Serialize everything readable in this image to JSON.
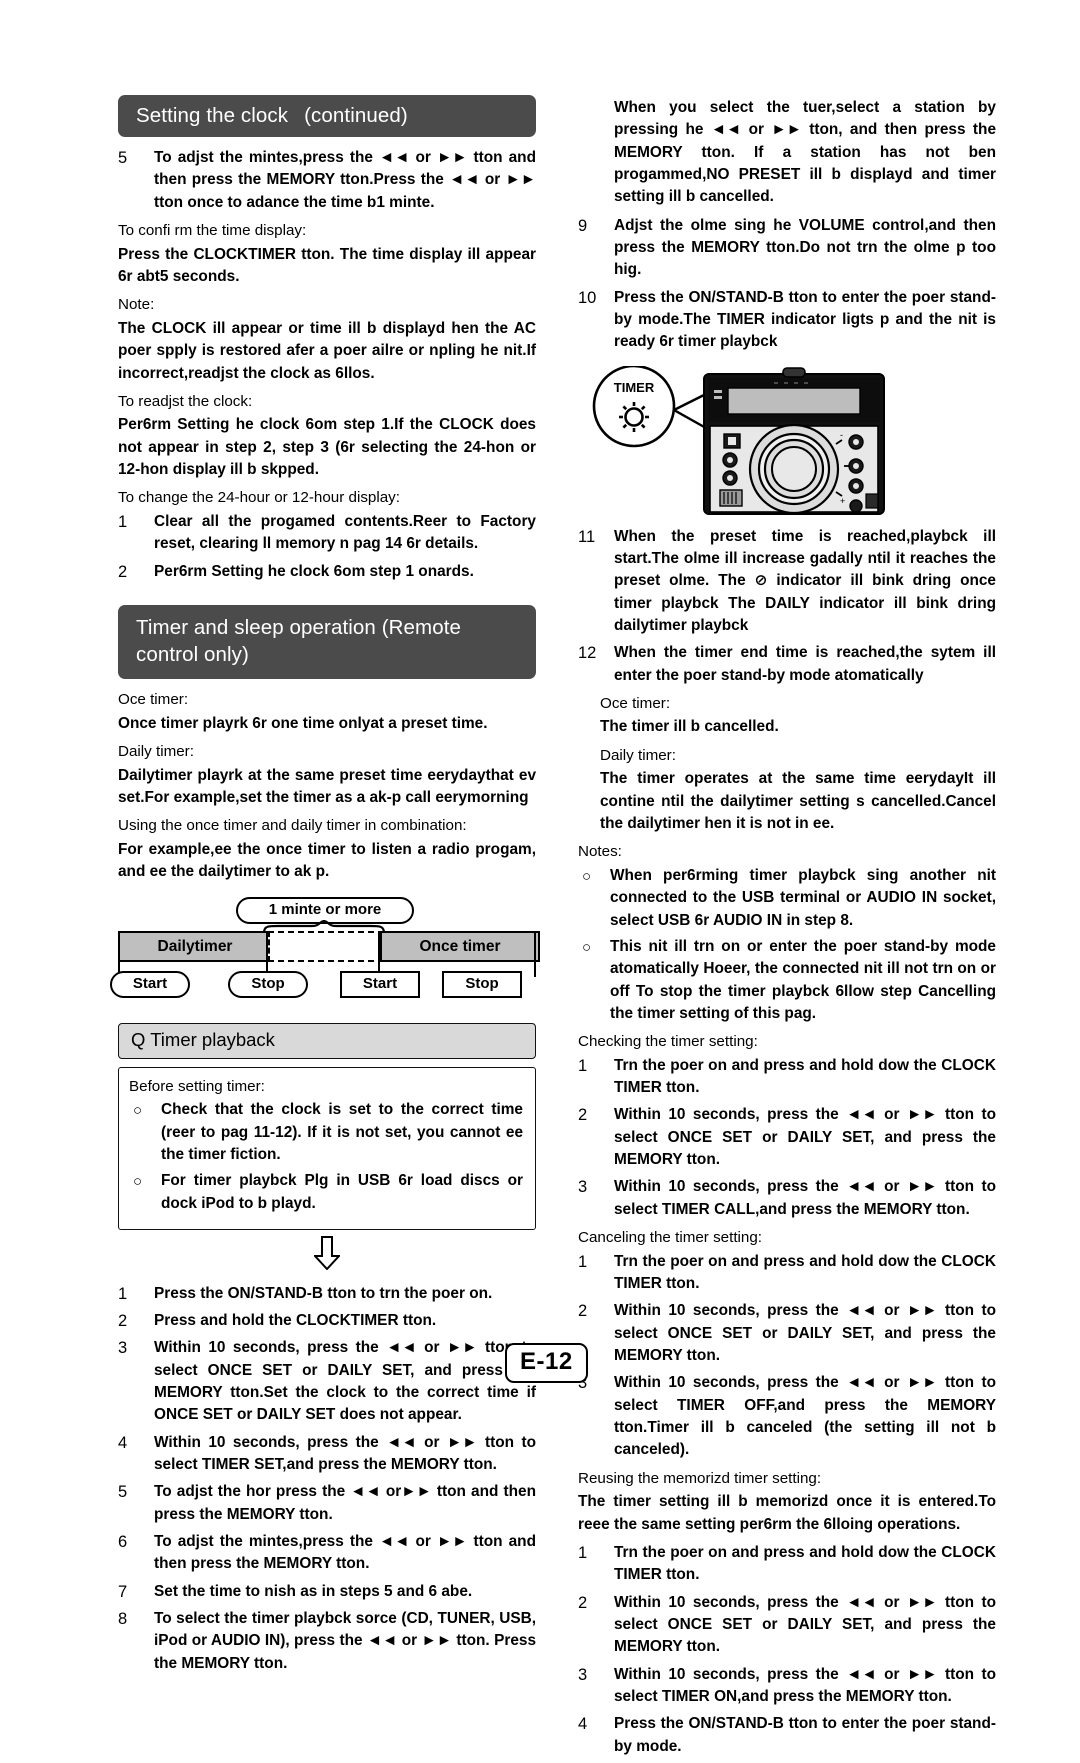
{
  "page": {
    "number_label": "E-12"
  },
  "left": {
    "heading": {
      "title": "Setting the clock",
      "continued": "(continued)"
    },
    "step5": {
      "num": "5",
      "text": "To adjst the mintes,press the  ◄◄ or ►► tton and then press the MEMORY tton.Press the  ◄◄ or ►► tton once to adance the time b1 minte."
    },
    "confirm_label": "To confi rm the time display:",
    "confirm_text": "Press the CLOCKTIMER tton. The time display ill appear 6r abt5 seconds.",
    "note_label": "Note:",
    "note_text": "The CLOCK ill appear or time ill b displayd hen the AC poer spply is restored afer a poer ailre or npling he nit.If incorrect,readjst the clock as 6llos.",
    "readjust_label": "To readjst the clock:",
    "readjust_text": "Per6rm Setting he clock 6om step 1.If the CLOCK does not appear in step 2, step 3 (6r selecting the 24-hon or 12-hon display ill b skpped.",
    "change_label": "To change the 24-hour or 12-hour display:",
    "change_steps": [
      {
        "num": "1",
        "text": "Clear all the progamed contents.Reer to Factory reset, clearing ll memory n pag   14 6r details."
      },
      {
        "num": "2",
        "text": "Per6rm Setting he clock 6om step 1 onards."
      }
    ],
    "timer_heading": {
      "line1": "Timer and sleep operation (Remote",
      "line2": "control only)"
    },
    "once_label": "Oce timer:",
    "once_text": "Once timer playrk 6r one time onlyat a preset time.",
    "daily_label": "Daily timer:",
    "daily_text": "Dailytimer playrk at the same preset time eerydaythat ev set.For example,set the timer as a ak-p call eerymorning",
    "combo_label": "Using the once timer and daily timer in combination:",
    "combo_text": "For example,ee the once timer to listen a radio progam, and ee the dailytimer to ak p.",
    "timeline": {
      "gap_label": "1 minte or more",
      "daily_band": "Dailytimer",
      "once_band": "Once timer",
      "daily_start": "Start",
      "daily_stop": "Stop",
      "once_start": "Start",
      "once_stop": "Stop"
    },
    "playback_heading": "Q  Timer playback",
    "before_box": {
      "label": "Before setting timer:",
      "items": [
        "Check that the clock is set to the correct time (reer to pag 11-12). If it is not set, you cannot ee the timer fiction.",
        "For timer playbck Plg in USB 6r load discs or dock iPod to b playd."
      ]
    },
    "steps": [
      {
        "num": "1",
        "text": "Press the ON/STAND-B tton to trn the poer on."
      },
      {
        "num": "2",
        "text": "Press and hold the CLOCKTIMER tton."
      },
      {
        "num": "3",
        "text": "Within 10 seconds, press the ◄◄ or ►► tton to select ONCE SET or DAILY SET, and press the MEMORY tton.Set the clock to the correct time if ONCE SET or DAILY SET does not appear."
      },
      {
        "num": "4",
        "text": "Within 10 seconds, press the ◄◄ or ►► tton to select TIMER SET,and press the MEMORY tton."
      },
      {
        "num": "5",
        "text": "To adjst the hor press the  ◄◄ or►► tton and then press the MEMORY tton."
      },
      {
        "num": "6",
        "text": "To adjst the mintes,press the  ◄◄ or ►► tton and then press the MEMORY tton."
      },
      {
        "num": "7",
        "text": "Set the time to nish as in steps 5 and 6 abe."
      },
      {
        "num": "8",
        "text": "To select the timer playbck sorce (CD, TUNER, USB, iPod or AUDIO IN), press the ◄◄ or ►► tton. Press the MEMORY tton."
      }
    ]
  },
  "right": {
    "tuner_note": "When you select the tuer,select a station by pressing he ◄◄ or ►► tton, and then press the MEMORY tton. If a station has not ben progammed,NO PRESET ill b displayd and timer setting ill b cancelled.",
    "steps_9_10": [
      {
        "num": "9",
        "text": "Adjst the olme sing he VOLUME control,and then press the MEMORY tton.Do not trn the olme p too hig."
      },
      {
        "num": "10",
        "text": "Press the ON/STAND-B tton to enter the poer stand-by mode.The TIMER indicator ligts p and the nit is ready 6r timer playbck"
      }
    ],
    "figure": {
      "callout_label": "TIMER",
      "indicator_name": "timer-indicator-glow"
    },
    "steps_11_12": [
      {
        "num": "11",
        "text": "When the preset time is reached,playbck ill start.The olme ill increase gadally ntil it reaches the preset olme. The  ⊘  indicator ill bink dring once timer playbck The DAILY indicator ill bink dring dailytimer playbck"
      },
      {
        "num": "12",
        "text": "When the timer end time is reached,the sytem ill enter the poer stand-by mode atomatically"
      }
    ],
    "once_label": "Oce timer:",
    "once_text": "The timer ill b cancelled.",
    "daily_label": "Daily timer:",
    "daily_text": "The timer operates at the same time eerydayIt ill contine ntil the dailytimer setting s cancelled.Cancel the dailytimer hen it is not in ee.",
    "notes_label": "Notes:",
    "notes": [
      "When per6rming timer playbck sing another  nit connected to the USB terminal or AUDIO IN socket, select USB 6r AUDIO IN in step 8.",
      "This nit ill trn on or enter the poer stand-by mode atomatically Hoeer, the connected nit ill not trn on or off To stop the timer playbck 6llow step        Cancelling the timer setting   of this pag."
    ],
    "checking_label": "Checking the timer setting:",
    "checking_steps": [
      {
        "num": "1",
        "text": "Trn the poer on and press and hold dow the CLOCK TIMER tton."
      },
      {
        "num": "2",
        "text": "Within 10 seconds, press the ◄◄ or ►► tton to select ONCE SET or DAILY SET, and press the MEMORY tton."
      },
      {
        "num": "3",
        "text": "Within 10 seconds, press the ◄◄ or ►► tton to select TIMER CALL,and press the MEMORY tton."
      }
    ],
    "canceling_label": "Canceling the timer setting:",
    "canceling_steps": [
      {
        "num": "1",
        "text": "Trn the poer on and press and hold dow the CLOCK TIMER tton."
      },
      {
        "num": "2",
        "text": "Within 10 seconds, press the ◄◄ or ►► tton to select ONCE SET or DAILY SET, and press the MEMORY tton."
      },
      {
        "num": "3",
        "text": "Within 10 seconds, press the ◄◄ or ►► tton to select TIMER OFF,and press the MEMORY tton.Timer ill b canceled (the setting ill not b canceled)."
      }
    ],
    "reusing_label": "Reusing the memorizd timer setting:",
    "reusing_text": "The timer setting ill b memorizd once it is entered.To reee the same setting per6rm the 6lloing operations.",
    "reusing_steps": [
      {
        "num": "1",
        "text": "Trn the poer on and press and hold dow the CLOCK TIMER tton."
      },
      {
        "num": "2",
        "text": "Within 10 seconds, press the ◄◄ or ►► tton to select ONCE SET or DAILY SET, and press the MEMORY tton."
      },
      {
        "num": "3",
        "text": "Within 10 seconds, press the ◄◄ or ►► tton to select TIMER ON,and press the MEMORY tton."
      },
      {
        "num": "4",
        "text": "Press the ON/STAND-B tton to enter the poer stand-by mode."
      }
    ]
  }
}
